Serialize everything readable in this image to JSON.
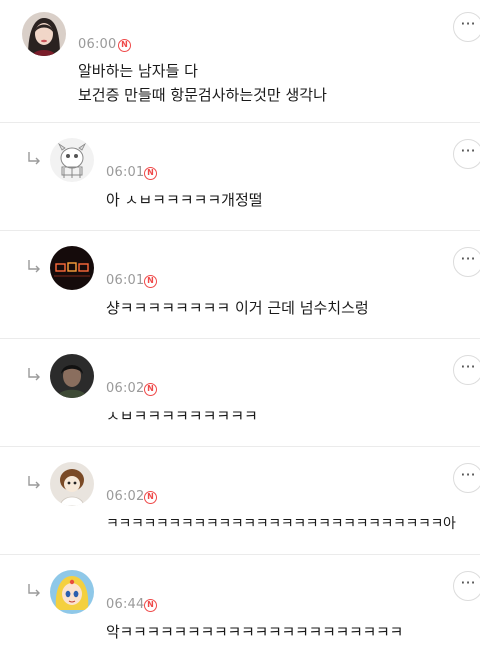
{
  "comments": [
    {
      "time": "06:00",
      "badge": "N",
      "lines": [
        "알바하는 남자들 다",
        "보건증 만들때 항문검사하는것만 생각나"
      ],
      "avatar": "woman-photo",
      "reply": false
    },
    {
      "time": "06:01",
      "badge": "N",
      "lines": [
        "아 ㅅㅂㅋㅋㅋㅋㅋ개정떨"
      ],
      "avatar": "cartoon-dog-sketch",
      "reply": true
    },
    {
      "time": "06:01",
      "badge": "N",
      "lines": [
        "샹ㅋㅋㅋㅋㅋㅋㅋㅋ 이거 근데 넘수치스렁"
      ],
      "avatar": "neon-sign",
      "reply": true
    },
    {
      "time": "06:02",
      "badge": "N",
      "lines": [
        "ㅅㅂㅋㅋㅋㅋㅋㅋㅋㅋㅋ"
      ],
      "avatar": "dark-portrait",
      "reply": true
    },
    {
      "time": "06:02",
      "badge": "N",
      "lines": [
        "ㅋㅋㅋㅋㅋㅋㅋㅋㅋㅋㅋㅋㅋㅋㅋㅋㅋㅋㅋㅋㅋㅋㅋㅋㅋㅋㅋ아"
      ],
      "avatar": "plush-doll",
      "reply": true
    },
    {
      "time": "06:44",
      "badge": "N",
      "lines": [
        "악ㅋㅋㅋㅋㅋㅋㅋㅋㅋㅋㅋㅋㅋㅋㅋㅋㅋㅋㅋㅋㅋ"
      ],
      "avatar": "anime-girl",
      "reply": true
    }
  ],
  "more_glyph": "···"
}
